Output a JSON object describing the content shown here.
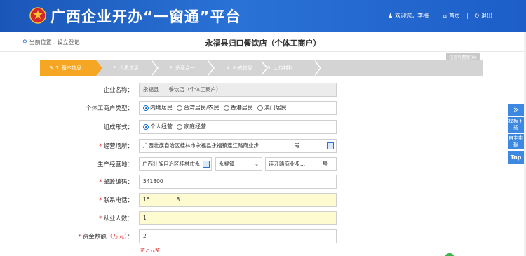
{
  "header": {
    "title": "广西企业开办“一窗通”平台",
    "welcome": "欢迎您，李梅",
    "home": "首页",
    "logout": "退出",
    "separator": "|"
  },
  "location": {
    "label": "当前位置：",
    "value": "设立登记"
  },
  "business_title": "永福县归口餐饮店（个体工商户）",
  "progress_text": "信息完整度0%",
  "steps": [
    {
      "label": "1. 基本信息",
      "active": true
    },
    {
      "label": "2. 人员信息",
      "active": false
    },
    {
      "label": "3. 多证合一",
      "active": false
    },
    {
      "label": "4. 补充信息",
      "active": false
    },
    {
      "label": "5. 上传材料",
      "active": false
    }
  ],
  "form": {
    "company_name": {
      "label": "企业名称：",
      "value_prefix": "永福县",
      "value_suffix": "餐饮店（个体工商户）"
    },
    "household_type": {
      "label": "个体工商户类型：",
      "options": [
        "内地居民",
        "台湾居民/农民",
        "香港居民",
        "澳门居民"
      ],
      "selected": "内地居民"
    },
    "org_form": {
      "label": "组成形式：",
      "options": [
        "个人经营",
        "家庭经营"
      ],
      "selected": "个人经营"
    },
    "business_place": {
      "label": "经营场所：",
      "value": "广西壮族自治区桂林市永福县永福镇连江路商业步",
      "suffix": "号"
    },
    "production_place": {
      "label": "生产经营地：",
      "region": "广西壮族自治区桂林市永",
      "town": "永福镇",
      "street": "连江路商业步...",
      "suffix": "号"
    },
    "postal_code": {
      "label": "邮政编码：",
      "value": "541800"
    },
    "phone": {
      "label": "联系电话：",
      "value_prefix": "15",
      "value_suffix": "8"
    },
    "employees": {
      "label": "从业人数：",
      "value": "1"
    },
    "capital": {
      "label": "资金数额",
      "unit": "（万元）",
      "colon": "：",
      "value": "2"
    }
  },
  "capital_hint": "贰万元整",
  "side_tools": {
    "arrow": "»",
    "template_download": "模板下载",
    "self_report": "自主申报",
    "top": "Top"
  },
  "colors": {
    "header_blue": "#1d5ec8",
    "step_active": "#f5a623",
    "step_inactive": "#d4d4d4",
    "required_red": "#e03030",
    "highlight_yellow": "#fffbd0",
    "side_btn_blue": "#3d88e0"
  }
}
